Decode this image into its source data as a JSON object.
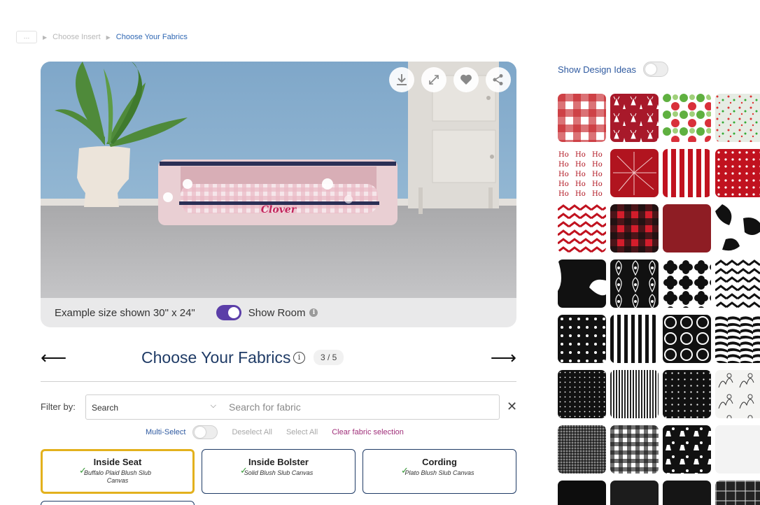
{
  "breadcrumb": {
    "home": "…",
    "items": [
      {
        "label": "Choose Insert",
        "active": false
      },
      {
        "label": "Choose Your Fabrics",
        "active": true
      }
    ]
  },
  "preview": {
    "size_text": "Example size shown 30\" x 24\"",
    "show_room_label": "Show Room",
    "show_room_on": true,
    "monogram": "Clover",
    "tools": [
      "download-icon",
      "fullscreen-icon",
      "heart-icon",
      "share-icon"
    ]
  },
  "step": {
    "title": "Choose Your Fabrics",
    "count": "3 / 5"
  },
  "filter": {
    "label": "Filter by:",
    "select_value": "Search",
    "search_placeholder": "Search for fabric"
  },
  "multi_select": {
    "label": "Multi-Select",
    "enabled": false,
    "deselect_all": "Deselect All",
    "select_all": "Select All",
    "clear": "Clear fabric selection"
  },
  "parts": [
    {
      "title": "Inside Seat",
      "fabric": "Buffalo Plaid Blush Slub Canvas",
      "selected": true
    },
    {
      "title": "Inside Bolster",
      "fabric": "Solid Blush Slub Canvas",
      "selected": false
    },
    {
      "title": "Cording",
      "fabric": "Plato Blush Slub Canvas",
      "selected": false
    }
  ],
  "design_ideas": {
    "label": "Show Design Ideas",
    "enabled": false
  },
  "colors": {
    "accent_purple": "#5b3ea8",
    "navy": "#1f3b66",
    "link_blue": "#2f5aa0",
    "selected_gold": "#e3b11d",
    "clear_magenta": "#a0307a"
  },
  "swatches": [
    [
      "red-buffalo-check",
      "red-deer-print",
      "green-red-dots",
      "confetti-dots"
    ],
    [
      "ho-ho-ho-text",
      "red-starburst",
      "red-white-stripe",
      "red-polka-dot"
    ],
    [
      "red-chevron",
      "red-black-buffalo-plaid",
      "solid-red",
      "cow-print"
    ],
    [
      "black-white-abstract",
      "black-damask",
      "black-quatrefoil",
      "black-chevron"
    ],
    [
      "black-polka-dot",
      "black-white-stripe",
      "black-circles",
      "zebra-print"
    ],
    [
      "black-mini-dot",
      "black-pinstripe",
      "black-star-dot",
      "black-toile"
    ],
    [
      "black-tweed",
      "black-gingham",
      "black-dog-print",
      "solid-white"
    ],
    [
      "solid-black",
      "solid-charcoal",
      "solid-black-2",
      "black-windowpane"
    ]
  ]
}
